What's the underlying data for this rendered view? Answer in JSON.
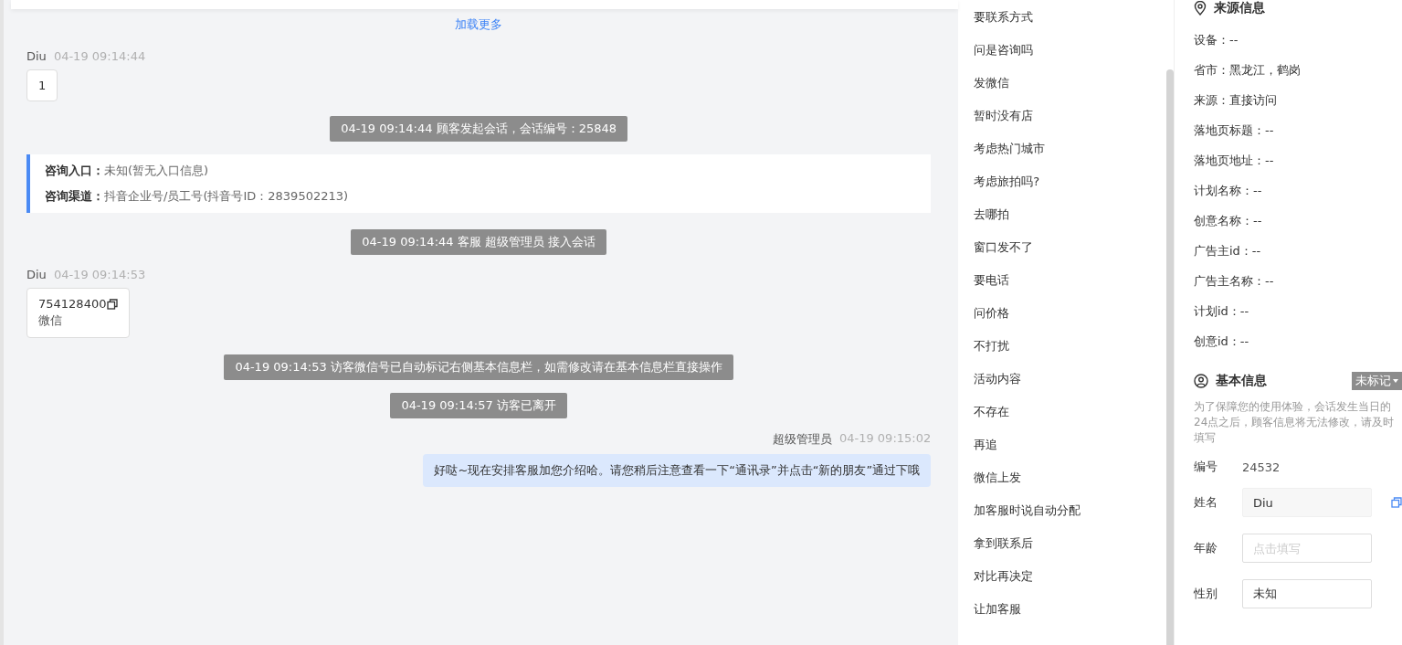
{
  "chat": {
    "load_more": "加载更多",
    "messages": [
      {
        "kind": "visitor",
        "sender": "Diu",
        "time": "04-19 09:14:44",
        "text": "1"
      },
      {
        "kind": "system",
        "text": "04-19 09:14:44 顾客发起会话，会话编号：25848"
      },
      {
        "kind": "entry",
        "rows": [
          {
            "label": "咨询入口：",
            "value": "未知(暂无入口信息)"
          },
          {
            "label": "咨询渠道：",
            "value": "抖音企业号/员工号(抖音号ID：2839502213)"
          }
        ]
      },
      {
        "kind": "system",
        "text": "04-19 09:14:44 客服 超级管理员 接入会话"
      },
      {
        "kind": "contact",
        "sender": "Diu",
        "time": "04-19 09:14:53",
        "text": "754128400",
        "sub": "微信"
      },
      {
        "kind": "system",
        "text": "04-19 09:14:53 访客微信号已自动标记右侧基本信息栏，如需修改请在基本信息栏直接操作"
      },
      {
        "kind": "system",
        "text": "04-19 09:14:57 访客已离开"
      },
      {
        "kind": "agent",
        "sender": "超级管理员",
        "time": "04-19 09:15:02",
        "text": "好哒~现在安排客服加您介绍哈。请您稍后注意查看一下“通讯录”并点击“新的朋友”通过下哦"
      }
    ]
  },
  "quick_replies": [
    "要联系方式",
    "问是咨询吗",
    "发微信",
    "暂时没有店",
    "考虑热门城市",
    "考虑旅拍吗?",
    "去哪拍",
    "窗口发不了",
    "要电话",
    "问价格",
    "不打扰",
    "活动内容",
    "不存在",
    "再追",
    "微信上发",
    "加客服时说自动分配",
    "拿到联系后",
    "对比再决定",
    "让加客服"
  ],
  "source_info": {
    "title": "来源信息",
    "rows": [
      "设备：--",
      "省市：黑龙江，鹤岗",
      "来源：直接访问",
      "落地页标题：--",
      "落地页地址：--",
      "计划名称：--",
      "创意名称：--",
      "广告主id：--",
      "广告主名称：--",
      "计划id：--",
      "创意id：--"
    ]
  },
  "basic_info": {
    "title": "基本信息",
    "tag": "未标记",
    "note": "为了保障您的使用体验，会话发生当日的24点之后，顾客信息将无法修改，请及时填写",
    "fields": [
      {
        "kind": "text",
        "label": "编号",
        "value": "24532"
      },
      {
        "kind": "filled",
        "label": "姓名",
        "value": "Diu"
      },
      {
        "kind": "input",
        "label": "年龄",
        "placeholder": "点击填写"
      },
      {
        "kind": "input",
        "label": "性别",
        "value": "未知"
      }
    ]
  }
}
